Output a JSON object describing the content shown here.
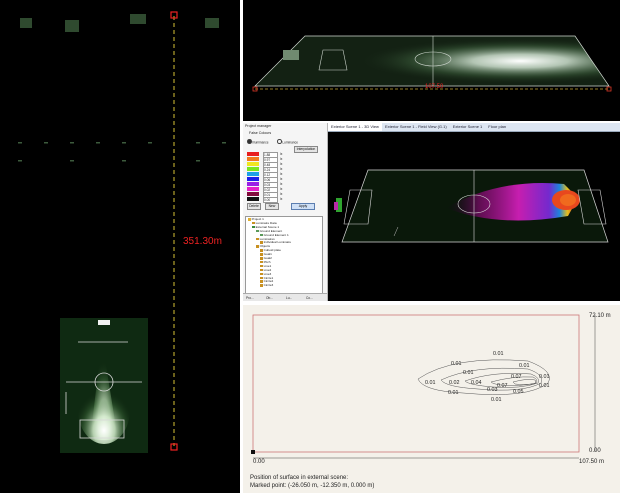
{
  "top_left": {
    "distance_label": "351.30m"
  },
  "top_right": {
    "dimension_label": "107.50"
  },
  "middle": {
    "sidepanel_title": "Project manager",
    "section_title": "False Colours",
    "radio_illuminance": "Illuminance",
    "radio_luminance": "Luminance",
    "interpolation_button": "Interpolation",
    "color_rows": [
      {
        "color": "#e81e1e",
        "value": "1.88",
        "unit": "lx"
      },
      {
        "color": "#f07a1e",
        "value": "0.97",
        "unit": "lx"
      },
      {
        "color": "#f0e61e",
        "value": "0.48",
        "unit": "lx"
      },
      {
        "color": "#7ae61e",
        "value": "0.24",
        "unit": "lx"
      },
      {
        "color": "#1ea0e6",
        "value": "0.12",
        "unit": "lx"
      },
      {
        "color": "#1e1ee8",
        "value": "0.06",
        "unit": "lx"
      },
      {
        "color": "#9a1ee6",
        "value": "0.03",
        "unit": "lx"
      },
      {
        "color": "#e61ec8",
        "value": "0.02",
        "unit": "lx"
      },
      {
        "color": "#820a3c",
        "value": "0.01",
        "unit": "lx"
      },
      {
        "color": "#111111",
        "value": "0.00",
        "unit": "lx"
      }
    ],
    "buttons": {
      "delete": "Delete",
      "new": "New",
      "apply": "Apply"
    },
    "tree": [
      {
        "label": "Project 1",
        "indent": 0,
        "icon": "#e0b030"
      },
      {
        "label": "Luminaire Data",
        "indent": 1,
        "icon": "#c89020"
      },
      {
        "label": "External Scene 1",
        "indent": 1,
        "icon": "#3a8a3a"
      },
      {
        "label": "Ground Element",
        "indent": 2,
        "icon": "#5a9a5a"
      },
      {
        "label": "Ground Element 1",
        "indent": 3,
        "icon": "#5a9a5a"
      },
      {
        "label": "Luminaires",
        "indent": 2,
        "icon": "#c89020"
      },
      {
        "label": "Individual Luminaire",
        "indent": 3,
        "icon": "#c89020"
      },
      {
        "label": "Objects",
        "indent": 2,
        "icon": "#c89020"
      },
      {
        "label": "Cuboid plate",
        "indent": 3,
        "icon": "#c89020"
      },
      {
        "label": "Goal1",
        "indent": 3,
        "icon": "#c89020"
      },
      {
        "label": "Goal2",
        "indent": 3,
        "icon": "#c89020"
      },
      {
        "label": "Pitch",
        "indent": 3,
        "icon": "#c89020"
      },
      {
        "label": "Line1",
        "indent": 3,
        "icon": "#c89020"
      },
      {
        "label": "Line2",
        "indent": 3,
        "icon": "#c89020"
      },
      {
        "label": "Line3",
        "indent": 3,
        "icon": "#c89020"
      },
      {
        "label": "Circle1",
        "indent": 3,
        "icon": "#c89020"
      },
      {
        "label": "Circle2",
        "indent": 3,
        "icon": "#c89020"
      },
      {
        "label": "Circle3",
        "indent": 3,
        "icon": "#c89020"
      }
    ],
    "bottom_bar": [
      "Pro...",
      "Ob...",
      "Lu...",
      "Co..."
    ],
    "tabs": [
      {
        "label": "Exterior Scene 1 - 3D View",
        "active": true
      },
      {
        "label": "Exterior Scene 1 - Field View (G.1)",
        "active": false
      },
      {
        "label": "Exterior Scene 1",
        "active": false
      },
      {
        "label": "Floor plan",
        "active": false
      }
    ]
  },
  "bottom_right": {
    "y_top_label": "72.10 m",
    "y_bottom_label": "0.00",
    "x_left_label": "0.00",
    "x_right_label": "107.50 m",
    "iso_labels": [
      "0.01",
      "0.01",
      "0.01",
      "0.01",
      "0.01",
      "0.02",
      "0.04",
      "0.07",
      "0.07",
      "0.01",
      "0.03",
      "0.05",
      "0.01",
      "0.01",
      "0.01"
    ],
    "caption_line1": "Position of surface in external scene:",
    "caption_line2": "Marked point: (-26.050 m, -12.350 m, 0.000 m)"
  }
}
